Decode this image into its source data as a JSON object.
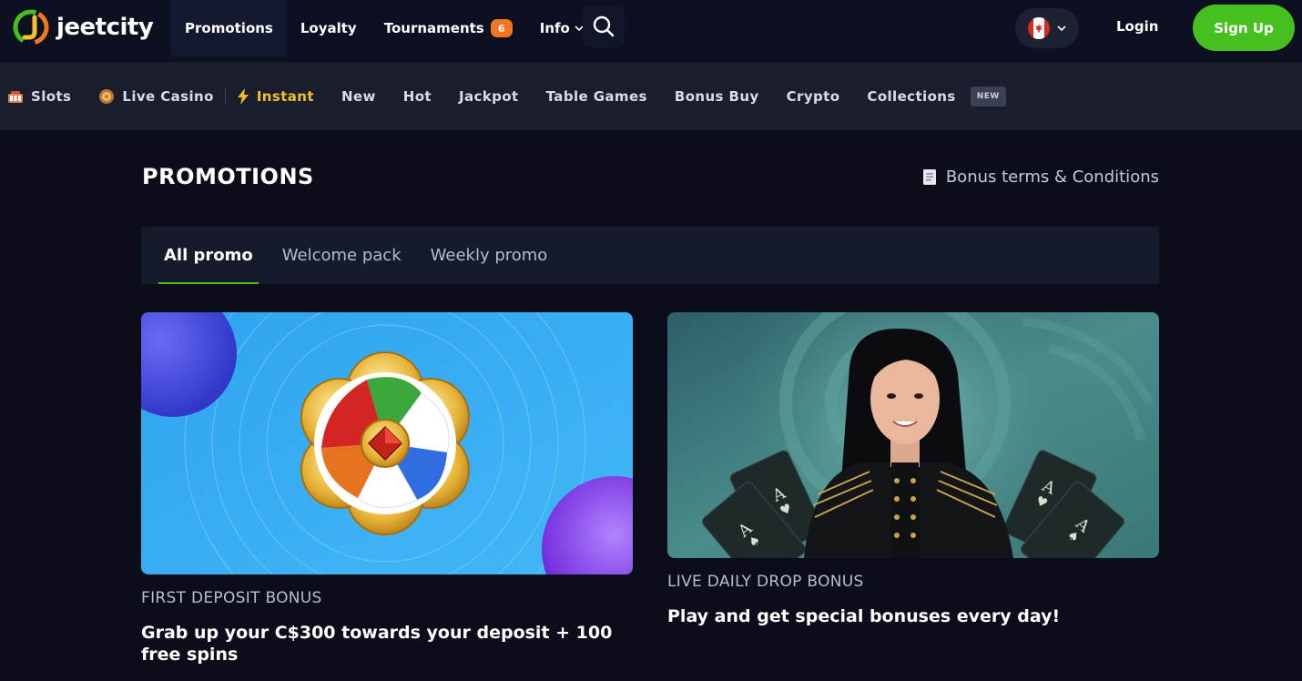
{
  "brand": {
    "name": "jeetcity"
  },
  "header": {
    "nav": [
      {
        "label": "Promotions"
      },
      {
        "label": "Loyalty"
      },
      {
        "label": "Tournaments",
        "badge": "6"
      },
      {
        "label": "Info"
      }
    ],
    "login_label": "Login",
    "signup_label": "Sign Up"
  },
  "categories": [
    {
      "label": "Slots",
      "icon": "slots-icon"
    },
    {
      "label": "Live Casino",
      "icon": "live-casino-icon"
    },
    {
      "label": "Instant",
      "icon": "lightning-icon"
    },
    {
      "label": "New"
    },
    {
      "label": "Hot"
    },
    {
      "label": "Jackpot"
    },
    {
      "label": "Table Games"
    },
    {
      "label": "Bonus Buy"
    },
    {
      "label": "Crypto"
    },
    {
      "label": "Collections",
      "badge": "NEW"
    }
  ],
  "page": {
    "title": "PROMOTIONS",
    "terms_label": "Bonus terms & Conditions"
  },
  "tabs": [
    {
      "label": "All promo"
    },
    {
      "label": "Welcome pack"
    },
    {
      "label": "Weekly promo"
    }
  ],
  "promos": [
    {
      "category": "FIRST DEPOSIT BONUS",
      "title": "Grab up your C$300 towards your deposit + 100 free spins"
    },
    {
      "category": "LIVE DAILY DROP BONUS",
      "title": "Play and get special bonuses every day!"
    }
  ],
  "colors": {
    "accent": "#45c01e",
    "badge": "#f0761f",
    "instant": "#f2c12e",
    "background": "#0b0e1a"
  }
}
